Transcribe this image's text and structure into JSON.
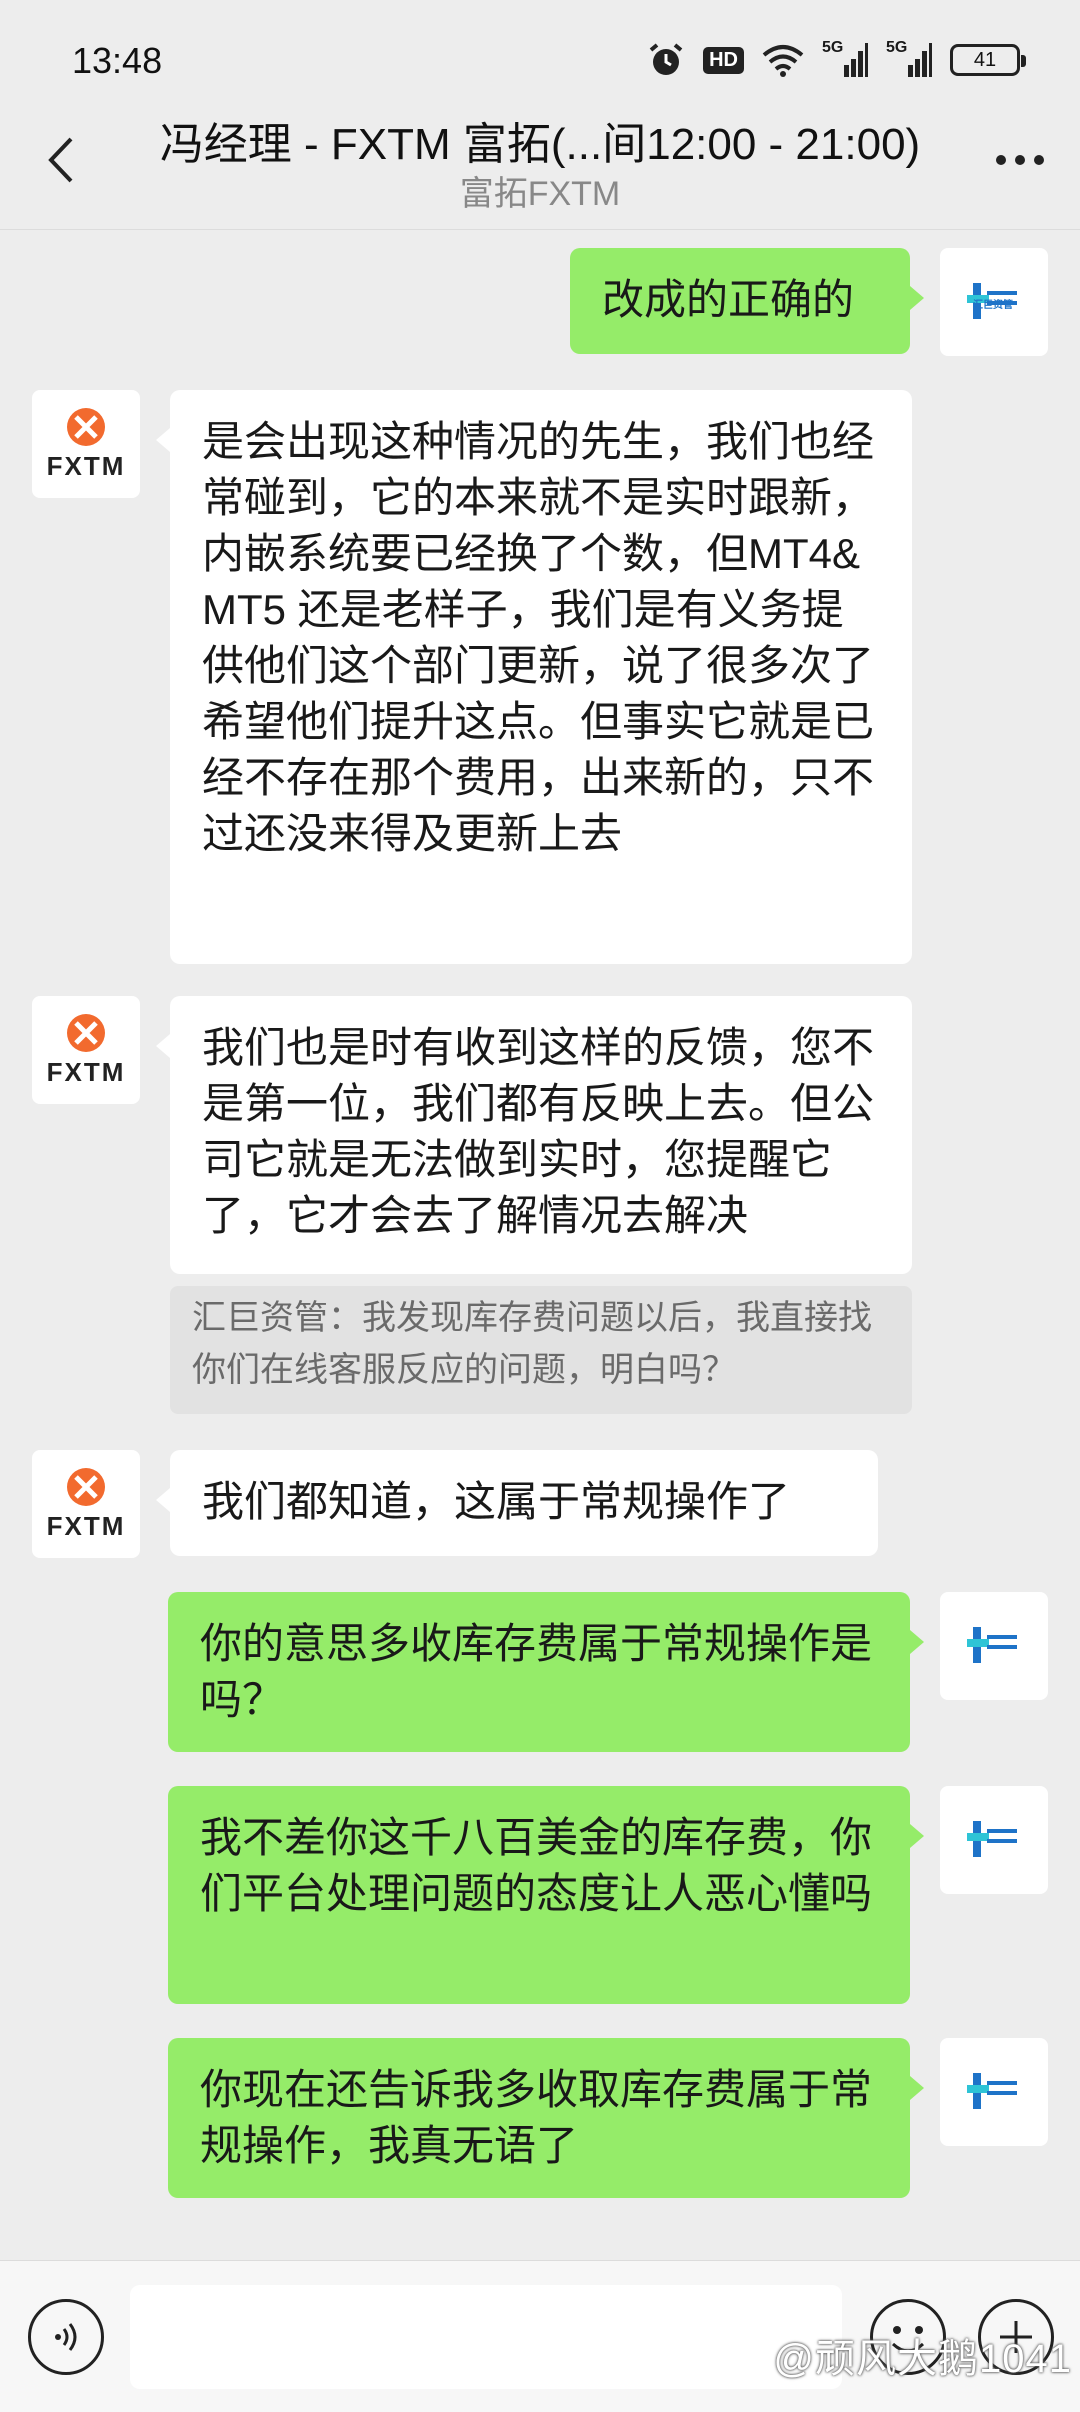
{
  "status_bar": {
    "time": "13:48",
    "hd_label": "HD",
    "net1": "5G",
    "net2": "5G",
    "battery": "41"
  },
  "header": {
    "title": "冯经理 - FXTM 富拓(...间12:00 - 21:00)",
    "subtitle": "富拓FXTM",
    "back_icon": "chevron-left-icon",
    "more_icon": "more-dots-icon"
  },
  "contacts": {
    "agent_logo_text": "FXTM",
    "self_logo_text": "汇巨资管"
  },
  "messages": [
    {
      "side": "out",
      "text": "改成的正确的"
    },
    {
      "side": "in",
      "text": "是会出现这种情况的先生，我们也经常碰到，它的本来就不是实时跟新，内嵌系统要已经换了个数，但MT4& MT5 还是老样子，我们是有义务提供他们这个部门更新，说了很多次了希望他们提升这点。但事实它就是已经不存在那个费用，出来新的，只不过还没来得及更新上去"
    },
    {
      "side": "in",
      "text": "我们也是时有收到这样的反馈，您不是第一位，我们都有反映上去。但公司它就是无法做到实时，您提醒它了，它才会去了解情况去解决",
      "quote": "汇巨资管：我发现库存费问题以后，我直接找你们在线客服反应的问题，明白吗？"
    },
    {
      "side": "in",
      "text": "我们都知道，这属于常规操作了"
    },
    {
      "side": "out",
      "text": "你的意思多收库存费属于常规操作是吗？"
    },
    {
      "side": "out",
      "text": "我不差你这千八百美金的库存费，你们平台处理问题的态度让人恶心懂吗"
    },
    {
      "side": "out",
      "text": "你现在还告诉我多收取库存费属于常规操作，我真无语了"
    }
  ],
  "input_bar": {
    "value": "",
    "voice_icon": "voice-icon",
    "emoji_icon": "emoji-icon",
    "plus_icon": "plus-icon"
  },
  "watermark": "@顽风大鹅1041",
  "colors": {
    "background": "#ededed",
    "bubble_out": "#95ec69",
    "bubble_in": "#ffffff",
    "fxtm_orange": "#f26a2e"
  }
}
